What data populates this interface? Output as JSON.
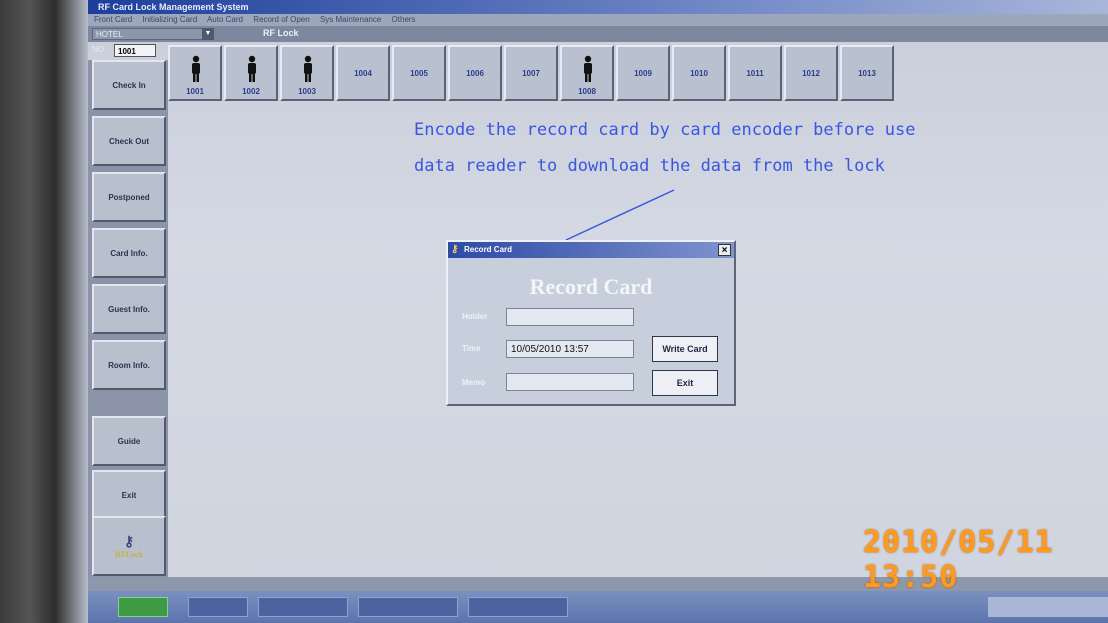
{
  "app": {
    "title": "RF Card Lock Management System",
    "menu": [
      "Front Card",
      "Initializing Card",
      "Auto Card",
      "Record of Open",
      "Sys Maintenance",
      "Others"
    ],
    "hotel_select": "HOTEL",
    "lock_type": "RF Lock",
    "room_field_label": "NO.",
    "room_field_value": "1001"
  },
  "sidebar": {
    "items": [
      {
        "label": "Check In"
      },
      {
        "label": "Check Out"
      },
      {
        "label": "Postponed"
      },
      {
        "label": "Card Info."
      },
      {
        "label": "Guest Info."
      },
      {
        "label": "Room Info."
      },
      {
        "label": "Guide"
      },
      {
        "label": "Exit"
      },
      {
        "label": "RFLock"
      }
    ]
  },
  "rooms": [
    {
      "number": "1001",
      "occupied": true
    },
    {
      "number": "1002",
      "occupied": true
    },
    {
      "number": "1003",
      "occupied": true
    },
    {
      "number": "1004",
      "occupied": false
    },
    {
      "number": "1005",
      "occupied": false
    },
    {
      "number": "1006",
      "occupied": false
    },
    {
      "number": "1007",
      "occupied": false
    },
    {
      "number": "1008",
      "occupied": true
    },
    {
      "number": "1009",
      "occupied": false
    },
    {
      "number": "1010",
      "occupied": false
    },
    {
      "number": "1011",
      "occupied": false
    },
    {
      "number": "1012",
      "occupied": false
    },
    {
      "number": "1013",
      "occupied": false
    }
  ],
  "annotation": {
    "line1": "Encode the record card by card encoder before use",
    "line2": "data reader to download the data from the lock"
  },
  "dialog": {
    "title": "Record Card",
    "heading": "Record Card",
    "holder_label": "Holder",
    "holder_value": "",
    "time_label": "Time",
    "time_value": "10/05/2010 13:57",
    "memo_label": "Memo",
    "memo_value": "",
    "write_button": "Write Card",
    "exit_button": "Exit",
    "close_glyph": "×"
  },
  "camera_timestamp": "2010/05/11 13:50",
  "colors": {
    "annotation": "#3a56e0",
    "timestamp": "#ff9a1f",
    "screen_bg": "#cfd4df"
  }
}
